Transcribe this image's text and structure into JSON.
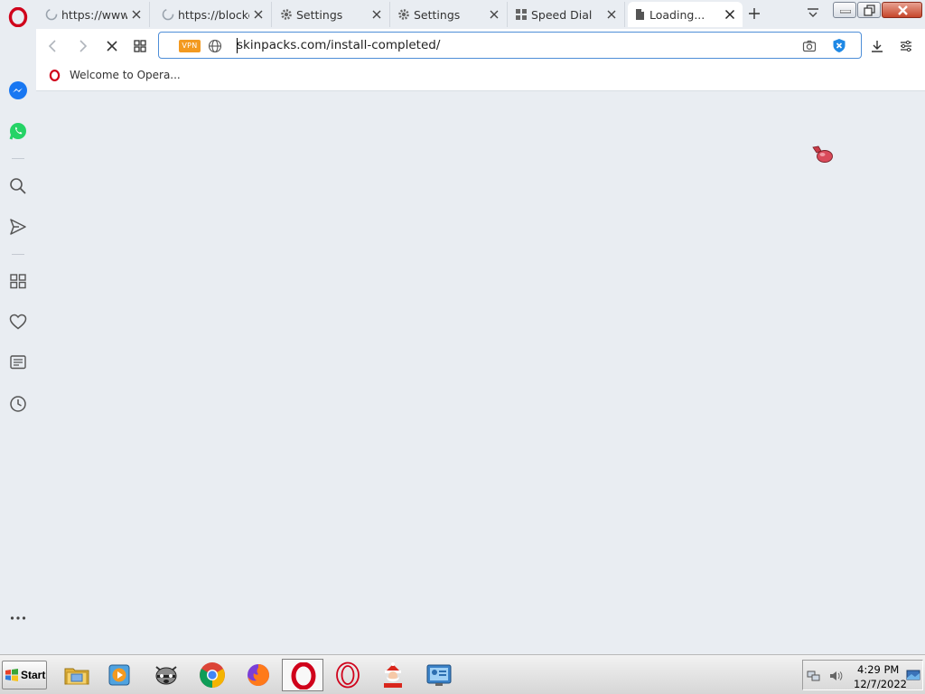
{
  "tabs": [
    {
      "title": "https://www.c",
      "icon": "loading-icon",
      "active": false
    },
    {
      "title": "https://blocke",
      "icon": "loading-icon",
      "active": false
    },
    {
      "title": "Settings",
      "icon": "gear-icon",
      "active": false
    },
    {
      "title": "Settings",
      "icon": "gear-icon",
      "active": false
    },
    {
      "title": "Speed Dial",
      "icon": "grid-icon",
      "active": false
    },
    {
      "title": "Loading...",
      "icon": "page-icon",
      "active": true
    }
  ],
  "address_bar": {
    "vpn_label": "VPN",
    "url": "skinpacks.com/install-completed/"
  },
  "bookmarks": [
    {
      "label": "Welcome to Opera..."
    }
  ],
  "sidebar": {
    "items": [
      "messenger-icon",
      "whatsapp-icon",
      "search-icon",
      "send-icon",
      "speed-dial-icon",
      "heart-icon",
      "news-icon",
      "history-icon",
      "more-icon"
    ]
  },
  "taskbar": {
    "start_label": "Start",
    "apps": [
      "file-explorer-icon",
      "media-player-icon",
      "raccoon-icon",
      "chrome-icon",
      "firefox-icon",
      "opera-icon",
      "opera-gx-icon",
      "santa-icon",
      "control-panel-icon"
    ],
    "clock_time": "4:29 PM",
    "clock_date": "12/7/2022"
  },
  "colors": {
    "opera_red": "#d0021b",
    "accent_blue": "#4e8ed8",
    "vpn_orange": "#f39a20",
    "background": "#e9edf2"
  }
}
